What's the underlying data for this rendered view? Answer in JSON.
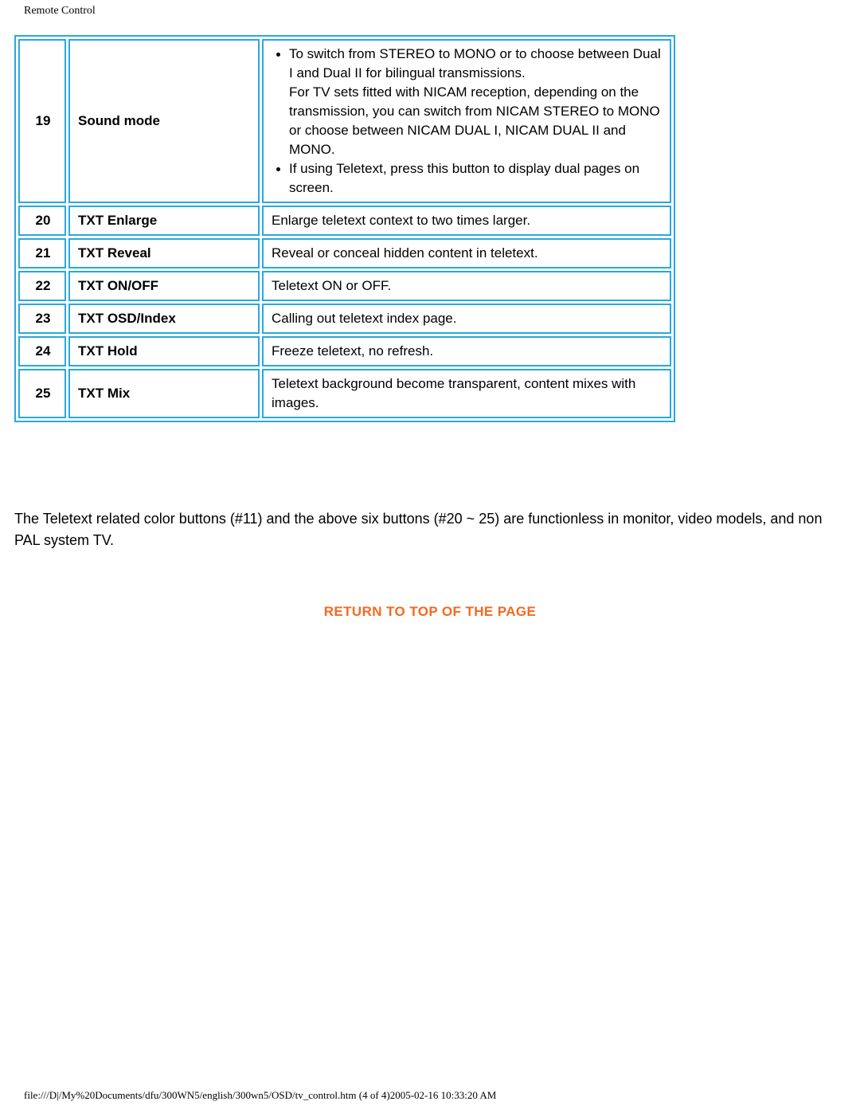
{
  "document": {
    "header": "Remote Control",
    "footer": "file:///D|/My%20Documents/dfu/300WN5/english/300wn5/OSD/tv_control.htm (4 of 4)2005-02-16 10:33:20 AM"
  },
  "colors": {
    "table_border": "#29a8e0",
    "link_orange": "#f26a21",
    "text": "#000000",
    "background": "#ffffff"
  },
  "table": {
    "rows": [
      {
        "number": "19",
        "name": "Sound mode",
        "description_type": "bullets",
        "bullets": [
          {
            "text": "To switch from STEREO to MONO or to choose between Dual I and Dual II for bilingual transmissions.",
            "continuation": "For TV sets fitted with NICAM reception, depending on the transmission, you can switch from NICAM STEREO to MONO or choose between NICAM DUAL I, NICAM DUAL II and MONO."
          },
          {
            "text": "If using Teletext, press this button to display dual pages on screen.",
            "continuation": ""
          }
        ]
      },
      {
        "number": "20",
        "name": "TXT Enlarge",
        "description_type": "plain",
        "description": "Enlarge teletext context to two times larger."
      },
      {
        "number": "21",
        "name": "TXT Reveal",
        "description_type": "plain",
        "description": "Reveal or conceal hidden content in teletext."
      },
      {
        "number": "22",
        "name": "TXT ON/OFF",
        "description_type": "plain",
        "description": "Teletext ON or OFF."
      },
      {
        "number": "23",
        "name": "TXT OSD/Index",
        "description_type": "plain",
        "description": "Calling out teletext index page."
      },
      {
        "number": "24",
        "name": "TXT Hold",
        "description_type": "plain",
        "description": "Freeze teletext, no refresh."
      },
      {
        "number": "25",
        "name": "TXT Mix",
        "description_type": "plain",
        "description": "Teletext background become transparent, content mixes with images."
      }
    ]
  },
  "note": {
    "text": "The Teletext related color buttons (#11) and the above six buttons (#20 ~ 25) are functionless in monitor, video models, and non PAL system TV."
  },
  "links": {
    "return_to_top": "RETURN TO TOP OF THE PAGE"
  }
}
